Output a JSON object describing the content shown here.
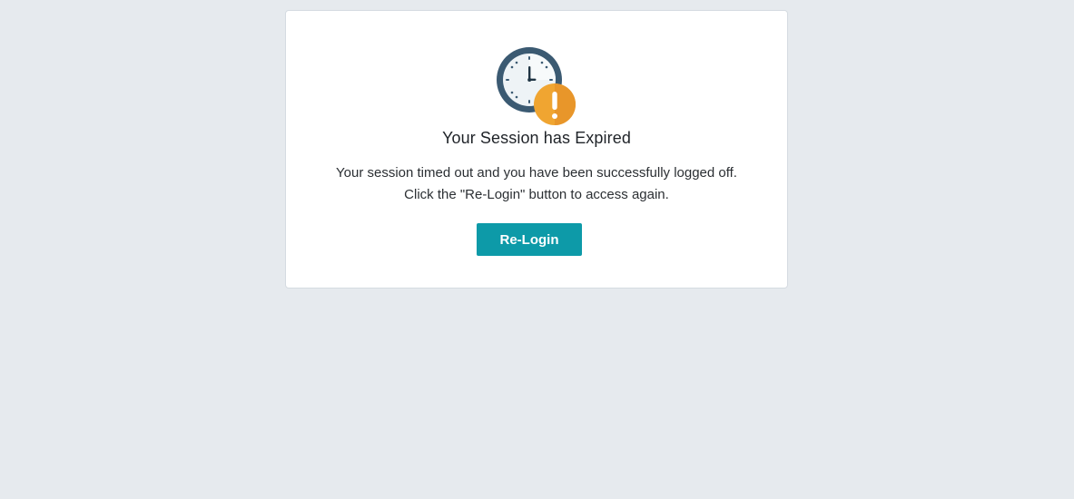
{
  "dialog": {
    "icon": "clock-warning-icon",
    "title": "Your Session has Expired",
    "message_line1": "Your session timed out and you have been successfully logged off.",
    "message_line2": "Click the \"Re-Login\" button to access again.",
    "button_label": "Re-Login"
  },
  "colors": {
    "background": "#e6eaee",
    "card": "#ffffff",
    "button": "#0d9aa8",
    "clock_ring": "#3b5a72",
    "warning": "#f0a531"
  }
}
